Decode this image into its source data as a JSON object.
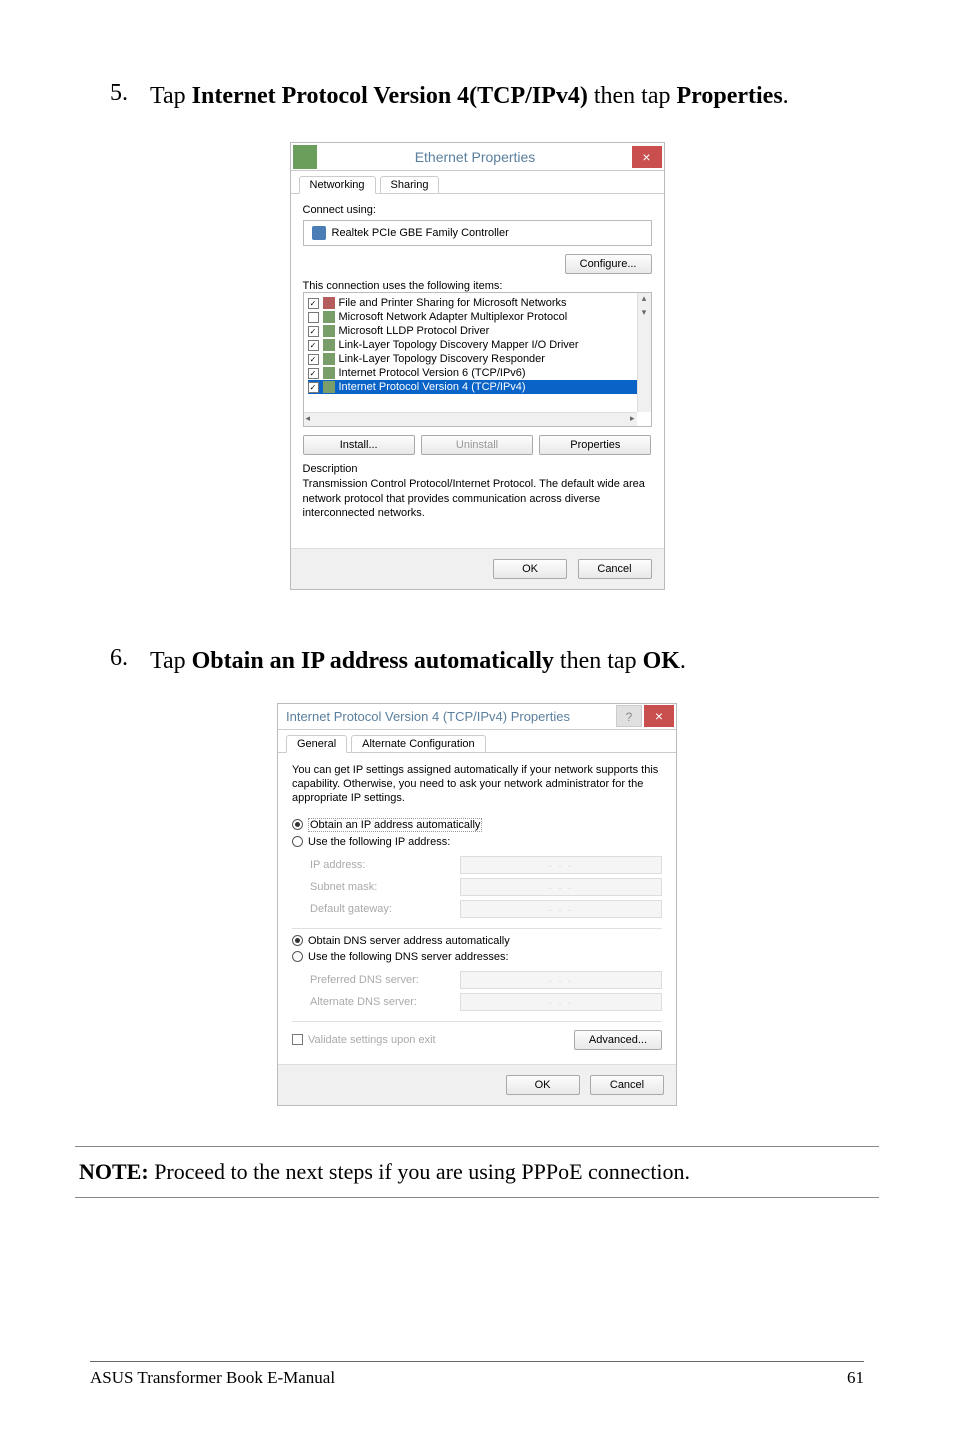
{
  "step5": {
    "num": "5.",
    "text_a": "Tap ",
    "bold_a": "Internet Protocol Version 4(TCP/IPv4)",
    "text_b": " then tap ",
    "bold_b": "Properties",
    "text_c": "."
  },
  "step6": {
    "num": "6.",
    "text_a": "Tap ",
    "bold_a": "Obtain an IP address automatically",
    "text_b": " then tap ",
    "bold_b": "OK",
    "text_c": "."
  },
  "dlg1": {
    "title": "Ethernet Properties",
    "tab_a": "Networking",
    "tab_b": "Sharing",
    "connect_using": "Connect using:",
    "adapter": "Realtek PCIe GBE Family Controller",
    "configure": "Configure...",
    "uses_label": "This connection uses the following items:",
    "items": [
      {
        "checked": true,
        "label": "File and Printer Sharing for Microsoft Networks"
      },
      {
        "checked": false,
        "label": "Microsoft Network Adapter Multiplexor Protocol"
      },
      {
        "checked": true,
        "label": "Microsoft LLDP Protocol Driver"
      },
      {
        "checked": true,
        "label": "Link-Layer Topology Discovery Mapper I/O Driver"
      },
      {
        "checked": true,
        "label": "Link-Layer Topology Discovery Responder"
      },
      {
        "checked": true,
        "label": "Internet Protocol Version 6 (TCP/IPv6)"
      },
      {
        "checked": true,
        "label": "Internet Protocol Version 4 (TCP/IPv4)"
      }
    ],
    "install": "Install...",
    "uninstall": "Uninstall",
    "properties": "Properties",
    "desc_label": "Description",
    "desc_text": "Transmission Control Protocol/Internet Protocol. The default wide area network protocol that provides communication across diverse interconnected networks.",
    "ok": "OK",
    "cancel": "Cancel"
  },
  "dlg2": {
    "title": "Internet Protocol Version 4 (TCP/IPv4) Properties",
    "tab_a": "General",
    "tab_b": "Alternate Configuration",
    "caption": "You can get IP settings assigned automatically if your network supports this capability. Otherwise, you need to ask your network administrator for the appropriate IP settings.",
    "r1": "Obtain an IP address automatically",
    "r2": "Use the following IP address:",
    "f_ip": "IP address:",
    "f_mask": "Subnet mask:",
    "f_gw": "Default gateway:",
    "r3": "Obtain DNS server address automatically",
    "r4": "Use the following DNS server addresses:",
    "f_pdns": "Preferred DNS server:",
    "f_adns": "Alternate DNS server:",
    "validate": "Validate settings upon exit",
    "advanced": "Advanced...",
    "ok": "OK",
    "cancel": "Cancel",
    "dots": ".   .   ."
  },
  "note": {
    "bold": "NOTE:",
    "text": " Proceed to the next steps if you are using PPPoE connection."
  },
  "footer": {
    "left": "ASUS Transformer Book E-Manual",
    "right": "61"
  }
}
